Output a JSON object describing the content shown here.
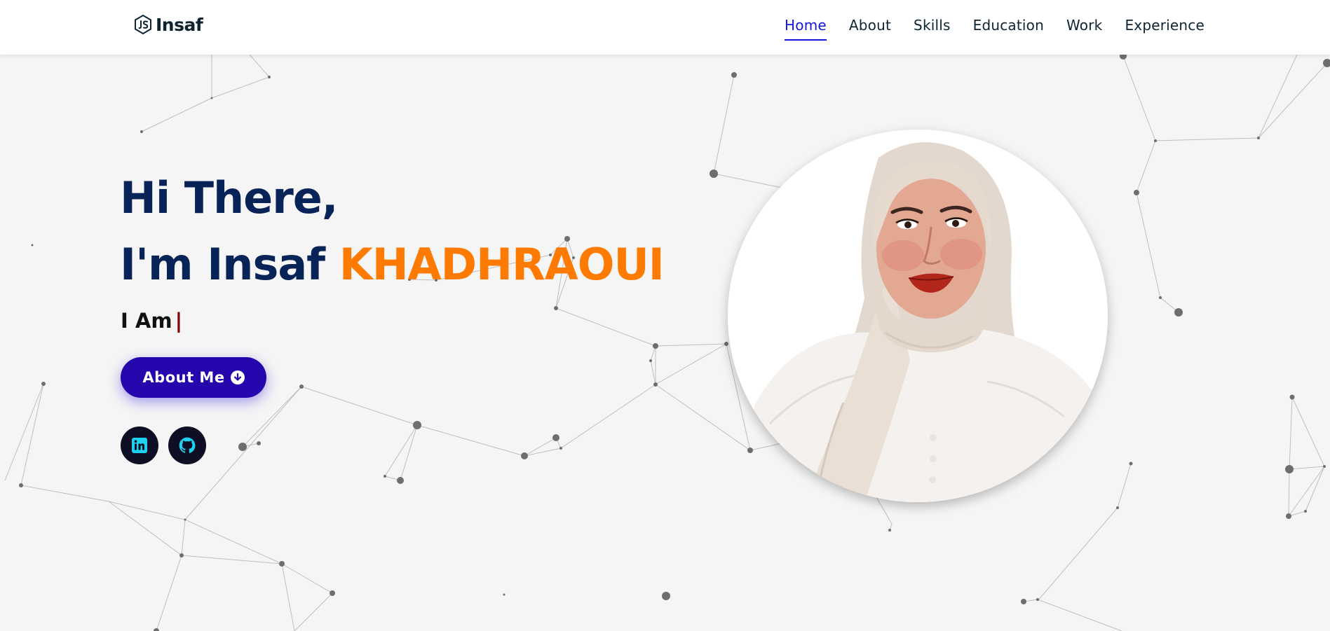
{
  "header": {
    "logo_icon": "js-hexagon-icon",
    "logo_text": "Insaf",
    "nav": [
      {
        "label": "Home",
        "active": true
      },
      {
        "label": "About",
        "active": false
      },
      {
        "label": "Skills",
        "active": false
      },
      {
        "label": "Education",
        "active": false
      },
      {
        "label": "Work",
        "active": false
      },
      {
        "label": "Experience",
        "active": false
      }
    ]
  },
  "hero": {
    "greeting": "Hi There,",
    "intro_prefix": "I'm Insaf ",
    "surname": "KHADHRAOUI",
    "typing_prefix": "I Am",
    "typing_cursor": "|",
    "about_button_label": "About Me",
    "about_button_icon": "arrow-circle-down-icon",
    "socials": [
      {
        "name": "LinkedIn",
        "icon": "linkedin-icon"
      },
      {
        "name": "GitHub",
        "icon": "github-icon"
      }
    ]
  },
  "colors": {
    "navy": "#072357",
    "orange": "#ff7a00",
    "button": "#2506ad",
    "nav_active": "#1414d8",
    "social_bg": "#0e0e24",
    "social_icon": "#1fd1f0"
  }
}
